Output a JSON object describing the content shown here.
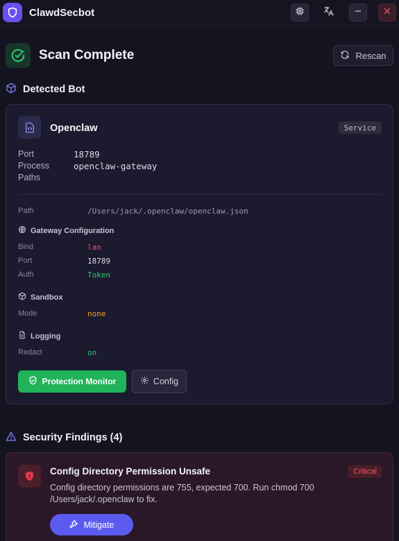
{
  "window": {
    "title": "ClawdSecbot",
    "buttons": [
      "chip-icon",
      "translate-icon",
      "minimize-icon",
      "close-icon"
    ]
  },
  "header": {
    "title": "Scan Complete",
    "rescan_label": "Rescan"
  },
  "detected_bot": {
    "section_title": "Detected Bot",
    "name": "Openclaw",
    "badge": "Service",
    "port_label": "Port",
    "port_value": "18789",
    "process_label": "Process",
    "process_value": "openclaw-gateway",
    "paths_label": "Paths",
    "path_label": "Path",
    "path_value": "/Users/jack/.openclaw/openclaw.json",
    "gateway": {
      "title": "Gateway Configuration",
      "bind_label": "Bind",
      "bind_value": "lan",
      "port_label": "Port",
      "port_value": "18789",
      "auth_label": "Auth",
      "auth_value": "Token"
    },
    "sandbox": {
      "title": "Sandbox",
      "mode_label": "Mode",
      "mode_value": "none"
    },
    "logging": {
      "title": "Logging",
      "redact_label": "Redact",
      "redact_value": "on"
    },
    "protection_button": "Protection Monitor",
    "config_button": "Config"
  },
  "findings": {
    "section_title": "Security Findings (4)",
    "items": [
      {
        "title": "Config Directory Permission Unsafe",
        "severity": "Critical",
        "description": "Config directory permissions are 755, expected 700. Run chmod 700 /Users/jack/.openclaw to fix.",
        "action": "Mitigate"
      }
    ]
  },
  "colors": {
    "accent": "#6c4ef0",
    "success": "#21b35a",
    "critical": "#f25462",
    "warning": "#f0a030",
    "primary_button": "#5b5bef"
  }
}
